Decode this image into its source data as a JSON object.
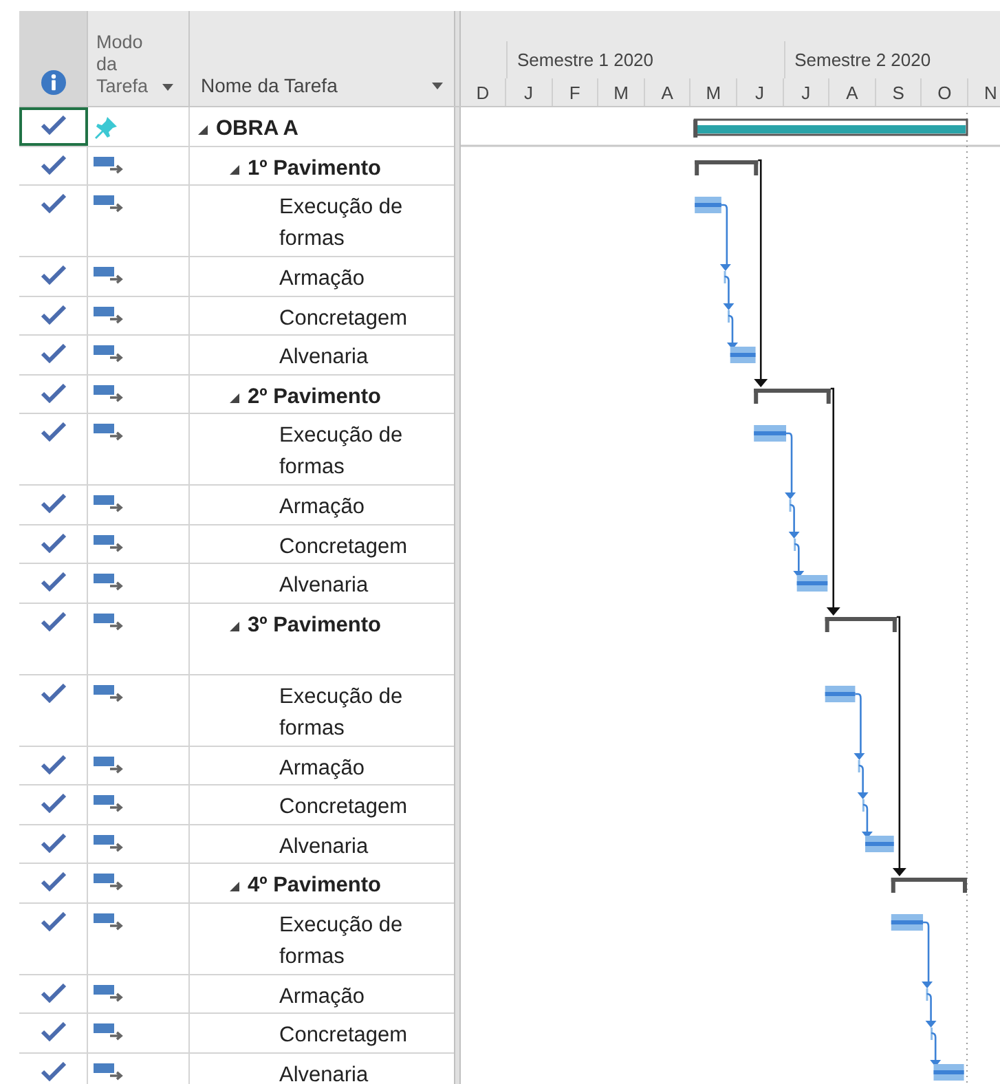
{
  "columns": [
    {
      "label": "Modo da Tarefa"
    },
    {
      "label": "Nome da Tarefa"
    }
  ],
  "timeline": {
    "semesters": [
      "Semestre 1 2020",
      "Semestre 2 2020"
    ],
    "months": [
      "D",
      "J",
      "F",
      "M",
      "A",
      "M",
      "J",
      "J",
      "A",
      "S",
      "O",
      "N"
    ]
  },
  "tasks": [
    {
      "name": "OBRA A",
      "kind": "manual",
      "complete": true,
      "selected": true,
      "expanded": true,
      "children": [
        {
          "name": "1º Pavimento",
          "kind": "auto",
          "complete": true,
          "selected": false,
          "expanded": true,
          "children": [
            {
              "name": "Execução de formas",
              "kind": "auto",
              "complete": true,
              "selected": false
            },
            {
              "name": "Armação",
              "kind": "auto",
              "complete": true,
              "selected": false
            },
            {
              "name": "Concretagem",
              "kind": "auto",
              "complete": true,
              "selected": false
            },
            {
              "name": "Alvenaria",
              "kind": "auto",
              "complete": true,
              "selected": false
            }
          ]
        },
        {
          "name": "2º Pavimento",
          "kind": "auto",
          "complete": true,
          "selected": false,
          "expanded": true,
          "children": [
            {
              "name": "Execução de formas",
              "kind": "auto",
              "complete": true,
              "selected": false
            },
            {
              "name": "Armação",
              "kind": "auto",
              "complete": true,
              "selected": false
            },
            {
              "name": "Concretagem",
              "kind": "auto",
              "complete": true,
              "selected": false
            },
            {
              "name": "Alvenaria",
              "kind": "auto",
              "complete": true,
              "selected": false
            }
          ]
        },
        {
          "name": "3º Pavimento",
          "kind": "auto",
          "complete": true,
          "selected": false,
          "expanded": true,
          "children": [
            {
              "name": "Execução de formas",
              "kind": "auto",
              "complete": true,
              "selected": false
            },
            {
              "name": "Armação",
              "kind": "auto",
              "complete": true,
              "selected": false
            },
            {
              "name": "Concretagem",
              "kind": "auto",
              "complete": true,
              "selected": false
            },
            {
              "name": "Alvenaria",
              "kind": "auto",
              "complete": true,
              "selected": false
            }
          ]
        },
        {
          "name": "4º Pavimento",
          "kind": "auto",
          "complete": true,
          "selected": false,
          "expanded": true,
          "children": [
            {
              "name": "Execução de formas",
              "kind": "auto",
              "complete": true,
              "selected": false
            },
            {
              "name": "Armação",
              "kind": "auto",
              "complete": true,
              "selected": false
            },
            {
              "name": "Concretagem",
              "kind": "auto",
              "complete": true,
              "selected": false
            },
            {
              "name": "Alvenaria",
              "kind": "auto",
              "complete": true,
              "selected": false
            }
          ]
        }
      ]
    }
  ]
}
